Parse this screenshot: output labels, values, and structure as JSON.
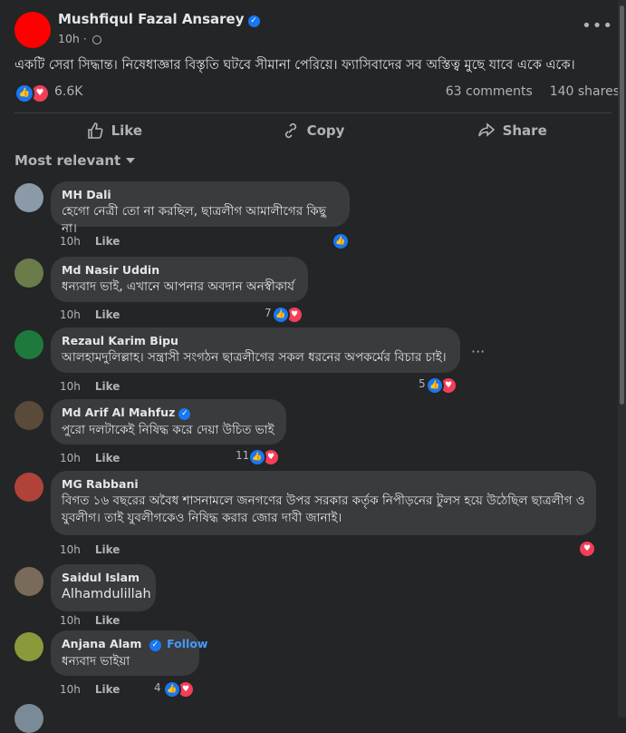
{
  "post": {
    "author": "Mushfiqul Fazal Ansarey",
    "time": "10h",
    "text": "একটি সেরা সিদ্ধান্ত। নিষেধাজ্ঞার বিস্তৃতি ঘটবে সীমানা পেরিয়ে। ফ্যাসিবাদের সব অস্তিত্ব মুছে যাবে একে একে।",
    "reaction_count": "6.6K",
    "comments_count": "63 comments",
    "shares_count": "140 shares",
    "more_label": "•••"
  },
  "actions": {
    "like": "Like",
    "copy": "Copy",
    "share": "Share"
  },
  "sort_label": "Most relevant",
  "comments": [
    {
      "name": "MH Dali",
      "text": "হেগো নেত্রী তো না করছিল, ছাত্রলীগ আমালীগের কিছু না।",
      "time": "10h",
      "like": "Like",
      "reacts": ""
    },
    {
      "name": "Md Nasir Uddin",
      "text": "ধন্যবাদ ভাই, এখানে আপনার অবদান অনস্বীকার্য",
      "time": "10h",
      "like": "Like",
      "reacts": "7"
    },
    {
      "name": "Rezaul Karim Bipu",
      "text": "আলহামদুলিল্লাহ। সন্ত্রাসী সংগঠন ছাত্রলীগের সকল ধরনের অপকর্মের বিচার চাই।",
      "time": "10h",
      "like": "Like",
      "reacts": "5"
    },
    {
      "name": "Md Arif Al Mahfuz",
      "text": "পুরো দলটাকেই নিষিদ্ধ করে দেয়া উচিত ভাই",
      "time": "10h",
      "like": "Like",
      "reacts": "11"
    },
    {
      "name": "MG Rabbani",
      "text": "বিগত ১৬ বছরের অবৈধ শাসনামলে জনগণের উপর সরকার কর্তৃক নিপীড়নের টুলস হয়ে উঠেছিল ছাত্রলীগ ও যুবলীগ। তাই যুবলীগকেও নিষিদ্ধ করার জোর দাবী জানাই।",
      "time": "10h",
      "like": "Like",
      "reacts": ""
    },
    {
      "name": "Saidul Islam",
      "text": "Alhamdulillah",
      "time": "10h",
      "like": "Like",
      "reacts": ""
    },
    {
      "name": "Anjana Alam",
      "text": "ধন্যবাদ ভাইয়া",
      "time": "10h",
      "like": "Like",
      "reacts": "4",
      "follow": "Follow"
    }
  ],
  "colors": {
    "background": "#242526",
    "bubble": "#3a3b3c",
    "like_blue": "#1877f2",
    "love_red": "#f33e58",
    "avatar_red": "#ff0000"
  },
  "icons": [
    "like-icon",
    "copy-icon",
    "share-icon",
    "globe-icon",
    "verified-icon",
    "more-icon"
  ]
}
